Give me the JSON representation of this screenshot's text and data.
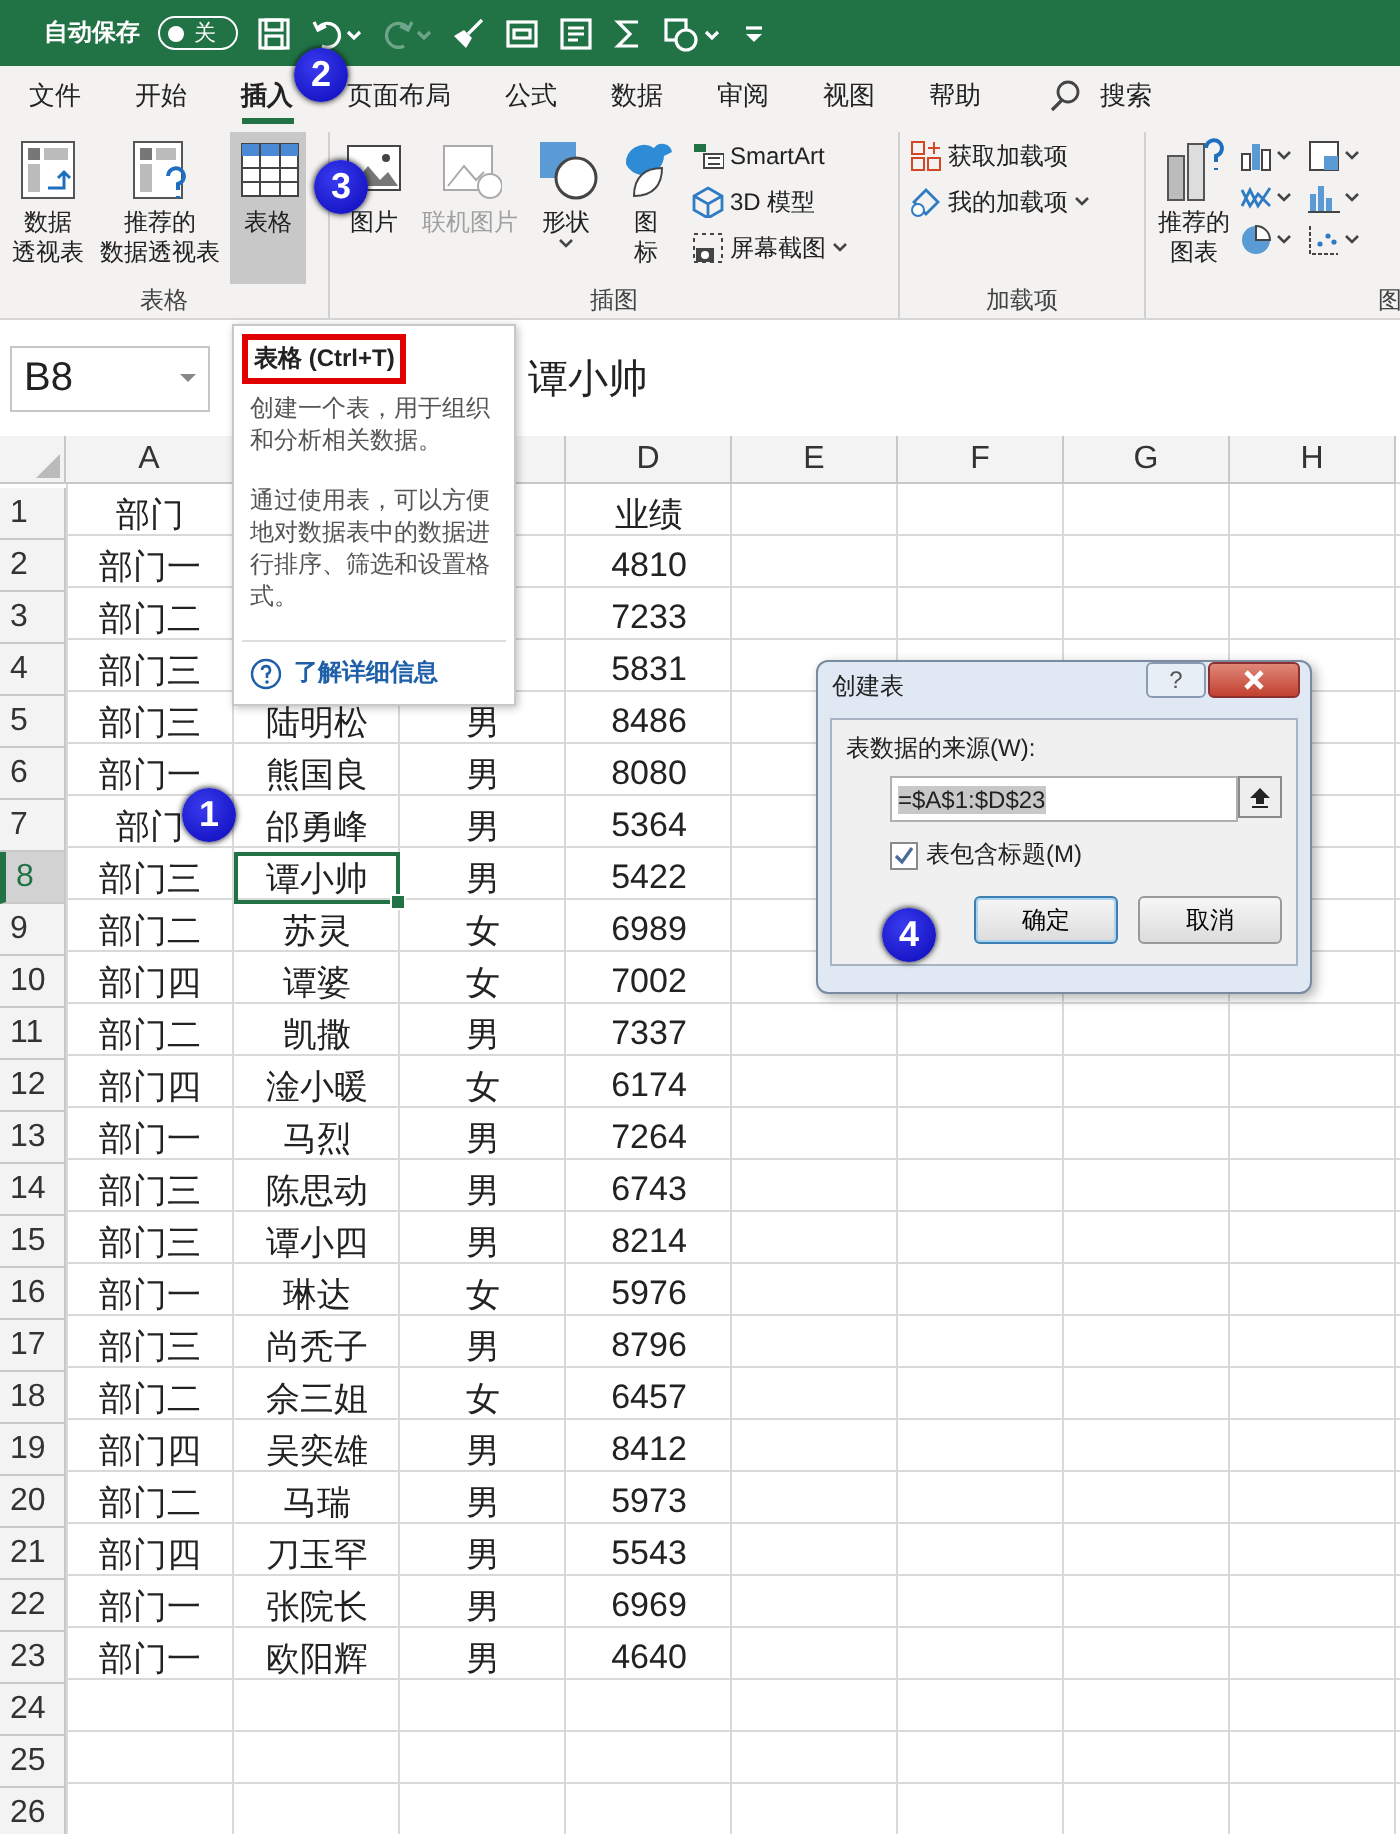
{
  "quick_access": {
    "autosave_label": "自动保存",
    "autosave": {
      "on": false,
      "label": "关"
    },
    "redo_disabled": true
  },
  "tabs": [
    {
      "label": "文件",
      "selected": false
    },
    {
      "label": "开始",
      "selected": false
    },
    {
      "label": "插入",
      "selected": true
    },
    {
      "label": "页面布局",
      "selected": false
    },
    {
      "label": "公式",
      "selected": false
    },
    {
      "label": "数据",
      "selected": false
    },
    {
      "label": "审阅",
      "selected": false
    },
    {
      "label": "视图",
      "selected": false
    },
    {
      "label": "帮助",
      "selected": false
    }
  ],
  "search": {
    "label": "搜索"
  },
  "ribbon_groups": [
    {
      "label": "表格",
      "buttons": [
        {
          "kind": "large",
          "lines": [
            "数据",
            "透视表"
          ],
          "selected": false,
          "disabled": false
        },
        {
          "kind": "large",
          "lines": [
            "推荐的",
            "数据透视表"
          ],
          "selected": false,
          "disabled": false
        },
        {
          "kind": "large",
          "lines": [
            "表格"
          ],
          "selected": true,
          "disabled": false
        }
      ]
    },
    {
      "label": "插图",
      "buttons": [
        {
          "kind": "large",
          "lines": [
            "图片"
          ],
          "selected": false,
          "disabled": false
        },
        {
          "kind": "large",
          "lines": [
            "联机图片"
          ],
          "selected": false,
          "disabled": true
        },
        {
          "kind": "large",
          "lines": [
            "形状"
          ],
          "caret": true,
          "selected": false,
          "disabled": false
        },
        {
          "kind": "large",
          "lines": [
            "图",
            "标"
          ],
          "selected": false,
          "disabled": false
        },
        {
          "kind": "stack",
          "items": [
            {
              "label": "SmartArt"
            },
            {
              "label": "3D 模型"
            },
            {
              "label": "屏幕截图",
              "caret": true
            }
          ]
        }
      ]
    },
    {
      "label": "加载项",
      "buttons": [
        {
          "kind": "stack",
          "items": [
            {
              "label": "获取加载项"
            },
            {
              "label": "我的加载项",
              "caret": true
            }
          ]
        }
      ]
    },
    {
      "label": "图",
      "buttons": [
        {
          "kind": "large",
          "lines": [
            "推荐的",
            "图表"
          ],
          "selected": false,
          "disabled": false
        },
        {
          "kind": "charts"
        }
      ]
    }
  ],
  "formula_bar": {
    "name_box": "B8",
    "formula": "谭小帅"
  },
  "grid": {
    "columns": {
      "a": "A",
      "d": "D",
      "e": "E",
      "f": "F",
      "g": "G",
      "h": "H"
    },
    "rows": [
      {
        "number": "1",
        "selected": false,
        "cells": {
          "a": "部门",
          "d": "业绩"
        }
      },
      {
        "number": "2",
        "selected": false,
        "cells": {
          "a": "部门一",
          "d": "4810"
        }
      },
      {
        "number": "3",
        "selected": false,
        "cells": {
          "a": "部门二",
          "d": "7233"
        }
      },
      {
        "number": "4",
        "selected": false,
        "cells": {
          "a": "部门三",
          "d": "5831"
        }
      },
      {
        "number": "5",
        "selected": false,
        "cells": {
          "a": "部门三",
          "b": "陆明松",
          "c": "男",
          "d": "8486"
        }
      },
      {
        "number": "6",
        "selected": false,
        "cells": {
          "a": "部门一",
          "b": "熊国良",
          "c": "男",
          "d": "8080"
        }
      },
      {
        "number": "7",
        "selected": false,
        "cells": {
          "a": "部门",
          "b": "邰勇峰",
          "c": "男",
          "d": "5364"
        }
      },
      {
        "number": "8",
        "selected": true,
        "cells": {
          "a": "部门三",
          "b": {
            "text": "谭小帅",
            "active": true
          },
          "c": "男",
          "d": "5422"
        }
      },
      {
        "number": "9",
        "selected": false,
        "cells": {
          "a": "部门二",
          "b": "苏灵",
          "c": "女",
          "d": "6989"
        }
      },
      {
        "number": "10",
        "selected": false,
        "cells": {
          "a": "部门四",
          "b": "谭婆",
          "c": "女",
          "d": "7002"
        }
      },
      {
        "number": "11",
        "selected": false,
        "cells": {
          "a": "部门二",
          "b": "凯撒",
          "c": "男",
          "d": "7337"
        }
      },
      {
        "number": "12",
        "selected": false,
        "cells": {
          "a": "部门四",
          "b": "淦小暖",
          "c": "女",
          "d": "6174"
        }
      },
      {
        "number": "13",
        "selected": false,
        "cells": {
          "a": "部门一",
          "b": "马烈",
          "c": "男",
          "d": "7264"
        }
      },
      {
        "number": "14",
        "selected": false,
        "cells": {
          "a": "部门三",
          "b": "陈思动",
          "c": "男",
          "d": "6743"
        }
      },
      {
        "number": "15",
        "selected": false,
        "cells": {
          "a": "部门三",
          "b": "谭小四",
          "c": "男",
          "d": "8214"
        }
      },
      {
        "number": "16",
        "selected": false,
        "cells": {
          "a": "部门一",
          "b": "琳达",
          "c": "女",
          "d": "5976"
        }
      },
      {
        "number": "17",
        "selected": false,
        "cells": {
          "a": "部门三",
          "b": "尚秃子",
          "c": "男",
          "d": "8796"
        }
      },
      {
        "number": "18",
        "selected": false,
        "cells": {
          "a": "部门二",
          "b": "佘三姐",
          "c": "女",
          "d": "6457"
        }
      },
      {
        "number": "19",
        "selected": false,
        "cells": {
          "a": "部门四",
          "b": "吴奕雄",
          "c": "男",
          "d": "8412"
        }
      },
      {
        "number": "20",
        "selected": false,
        "cells": {
          "a": "部门二",
          "b": "马瑞",
          "c": "男",
          "d": "5973"
        }
      },
      {
        "number": "21",
        "selected": false,
        "cells": {
          "a": "部门四",
          "b": "刀玉罕",
          "c": "男",
          "d": "5543"
        }
      },
      {
        "number": "22",
        "selected": false,
        "cells": {
          "a": "部门一",
          "b": "张院长",
          "c": "男",
          "d": "6969"
        }
      },
      {
        "number": "23",
        "selected": false,
        "cells": {
          "a": "部门一",
          "b": "欧阳辉",
          "c": "男",
          "d": "4640"
        }
      },
      {
        "number": "24",
        "selected": false,
        "cells": {}
      },
      {
        "number": "25",
        "selected": false,
        "cells": {}
      },
      {
        "number": "26",
        "selected": false,
        "cells": {}
      }
    ]
  },
  "tooltip": {
    "title": "表格 (Ctrl+T)",
    "paragraphs": [
      "创建一个表，用于组织和分析相关数据。",
      "通过使用表，可以方便地对数据表中的数据进行排序、筛选和设置格式。"
    ],
    "link": "了解详细信息"
  },
  "dialog": {
    "title": "创建表",
    "help": "?",
    "source_label": "表数据的来源(W):",
    "source_value": "=$A$1:$D$23",
    "header_checkbox": {
      "label": "表包含标题(M)",
      "checked": true
    },
    "buttons": [
      {
        "label": "确定",
        "default": true
      },
      {
        "label": "取消",
        "default": false
      }
    ]
  },
  "callouts": [
    {
      "label": "1"
    },
    {
      "label": "2"
    },
    {
      "label": "3"
    },
    {
      "label": "4"
    }
  ]
}
